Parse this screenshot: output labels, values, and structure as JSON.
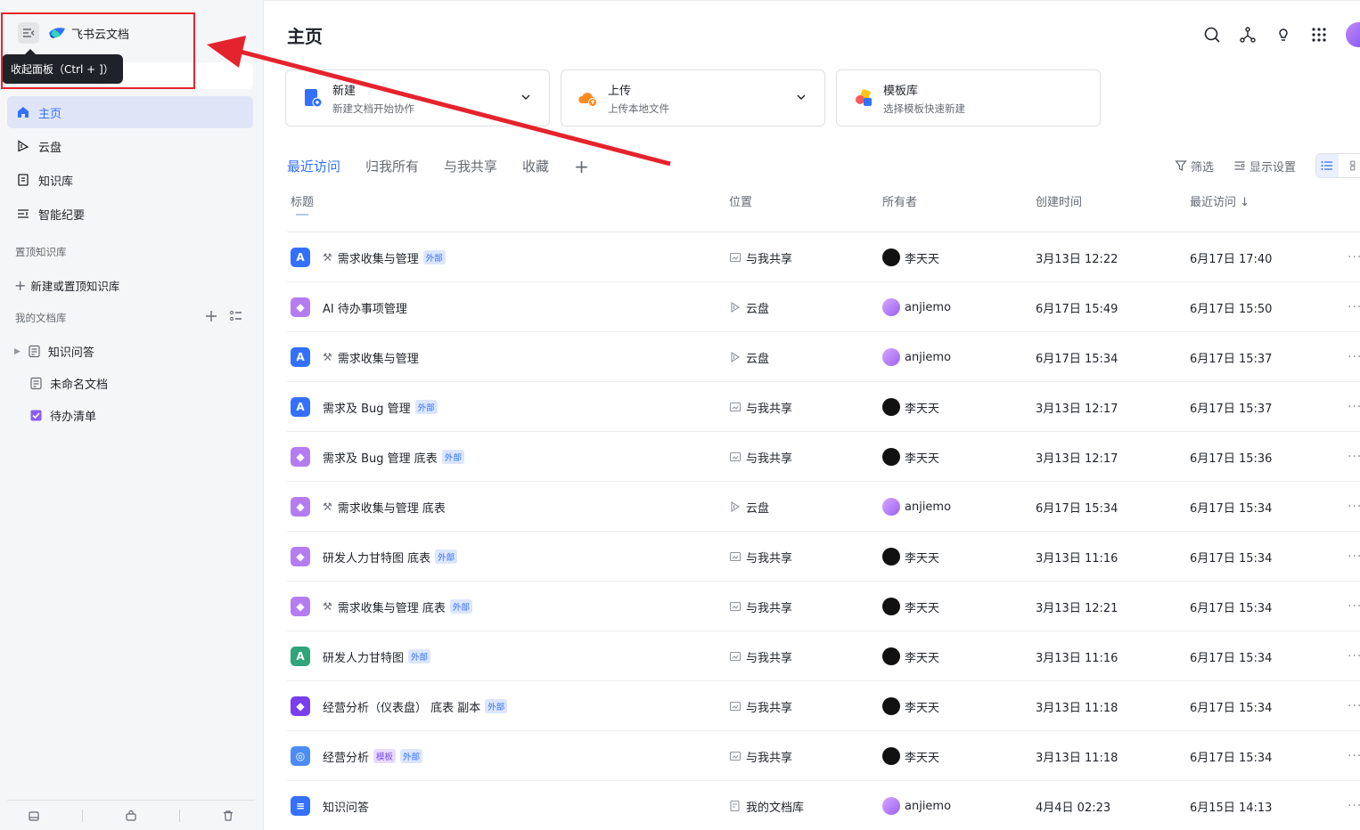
{
  "sidebar": {
    "app_name": "飞书云文档",
    "tooltip": "收起面板（Ctrl + ]）",
    "nav": [
      {
        "label": "主页",
        "icon": "home-icon",
        "active": true
      },
      {
        "label": "云盘",
        "icon": "drive-icon",
        "active": false
      },
      {
        "label": "知识库",
        "icon": "wiki-icon",
        "active": false
      },
      {
        "label": "智能纪要",
        "icon": "minutes-icon",
        "active": false
      }
    ],
    "pinned_label": "置顶知识库",
    "new_pinned_label": "新建或置顶知识库",
    "my_library_label": "我的文档库",
    "tree": [
      {
        "label": "知识问答",
        "icon": "doc-icon",
        "expandable": true
      },
      {
        "label": "未命名文档",
        "icon": "doc-icon",
        "expandable": false
      },
      {
        "label": "待办清单",
        "icon": "checkbox-icon",
        "expandable": false
      }
    ]
  },
  "main": {
    "title": "主页",
    "cards": [
      {
        "title": "新建",
        "subtitle": "新建文档开始协作"
      },
      {
        "title": "上传",
        "subtitle": "上传本地文件"
      },
      {
        "title": "模板库",
        "subtitle": "选择模板快速新建"
      }
    ],
    "tabs": [
      "最近访问",
      "归我所有",
      "与我共享",
      "收藏"
    ],
    "tab_add": "+",
    "tools": {
      "filter": "筛选",
      "display": "显示设置"
    },
    "columns": {
      "title": "标题",
      "location": "位置",
      "owner": "所有者",
      "created": "创建时间",
      "visited": "最近访问 ↓"
    },
    "rows": [
      {
        "title": "需求收集与管理",
        "emoji": true,
        "tags": [
          "外部"
        ],
        "icon_color": "#3370ff",
        "icon": "A",
        "location": "与我共享",
        "loc_icon": "shared",
        "owner": "李天天",
        "owner_style": "black",
        "created": "3月13日 12:22",
        "visited": "6月17日 17:40"
      },
      {
        "title": "AI 待办事项管理",
        "emoji": false,
        "tags": [],
        "icon_color": "#b57cf2",
        "icon": "◆",
        "location": "云盘",
        "loc_icon": "drive",
        "owner": "anjiemo",
        "owner_style": "purple",
        "created": "6月17日 15:49",
        "visited": "6月17日 15:50"
      },
      {
        "title": "需求收集与管理",
        "emoji": true,
        "tags": [],
        "icon_color": "#3370ff",
        "icon": "A",
        "location": "云盘",
        "loc_icon": "drive",
        "owner": "anjiemo",
        "owner_style": "purple",
        "created": "6月17日 15:34",
        "visited": "6月17日 15:37"
      },
      {
        "title": "需求及 Bug 管理",
        "emoji": false,
        "tags": [
          "外部"
        ],
        "icon_color": "#3370ff",
        "icon": "A",
        "location": "与我共享",
        "loc_icon": "shared",
        "owner": "李天天",
        "owner_style": "black",
        "created": "3月13日 12:17",
        "visited": "6月17日 15:37"
      },
      {
        "title": "需求及 Bug 管理 底表",
        "emoji": false,
        "tags": [
          "外部"
        ],
        "icon_color": "#b57cf2",
        "icon": "◆",
        "location": "与我共享",
        "loc_icon": "shared",
        "owner": "李天天",
        "owner_style": "black",
        "created": "3月13日 12:17",
        "visited": "6月17日 15:36"
      },
      {
        "title": "需求收集与管理 底表",
        "emoji": true,
        "tags": [],
        "icon_color": "#b57cf2",
        "icon": "◆",
        "location": "云盘",
        "loc_icon": "drive",
        "owner": "anjiemo",
        "owner_style": "purple",
        "created": "6月17日 15:34",
        "visited": "6月17日 15:34"
      },
      {
        "title": "研发人力甘特图 底表",
        "emoji": false,
        "tags": [
          "外部"
        ],
        "icon_color": "#b57cf2",
        "icon": "◆",
        "location": "与我共享",
        "loc_icon": "shared",
        "owner": "李天天",
        "owner_style": "black",
        "created": "3月13日 11:16",
        "visited": "6月17日 15:34"
      },
      {
        "title": "需求收集与管理 底表",
        "emoji": true,
        "tags": [
          "外部"
        ],
        "icon_color": "#b57cf2",
        "icon": "◆",
        "location": "与我共享",
        "loc_icon": "shared",
        "owner": "李天天",
        "owner_style": "black",
        "created": "3月13日 12:21",
        "visited": "6月17日 15:34"
      },
      {
        "title": "研发人力甘特图",
        "emoji": false,
        "tags": [
          "外部"
        ],
        "icon_color": "#2ea57a",
        "icon": "A",
        "location": "与我共享",
        "loc_icon": "shared",
        "owner": "李天天",
        "owner_style": "black",
        "created": "3月13日 11:16",
        "visited": "6月17日 15:34"
      },
      {
        "title": "经营分析（仪表盘） 底表 副本",
        "emoji": false,
        "tags": [
          "外部"
        ],
        "icon_color": "#7a3ef0",
        "icon": "◆",
        "location": "与我共享",
        "loc_icon": "shared",
        "owner": "李天天",
        "owner_style": "black",
        "created": "3月13日 11:18",
        "visited": "6月17日 15:34"
      },
      {
        "title": "经营分析",
        "emoji": false,
        "tags": [
          "模板",
          "外部"
        ],
        "icon_color": "#4d8bf5",
        "icon": "◎",
        "location": "与我共享",
        "loc_icon": "shared",
        "owner": "李天天",
        "owner_style": "black",
        "created": "3月13日 11:18",
        "visited": "6月17日 15:34"
      },
      {
        "title": "知识问答",
        "emoji": false,
        "tags": [],
        "icon_color": "#3370ff",
        "icon": "≡",
        "location": "我的文档库",
        "loc_icon": "library",
        "owner": "anjiemo",
        "owner_style": "purple",
        "created": "4月4日 02:23",
        "visited": "6月15日 14:13"
      }
    ],
    "row_more": "···"
  },
  "colors": {
    "accent": "#3370ff",
    "annotation": "#e5232c",
    "sidebar_bg": "#f5f6f7"
  }
}
